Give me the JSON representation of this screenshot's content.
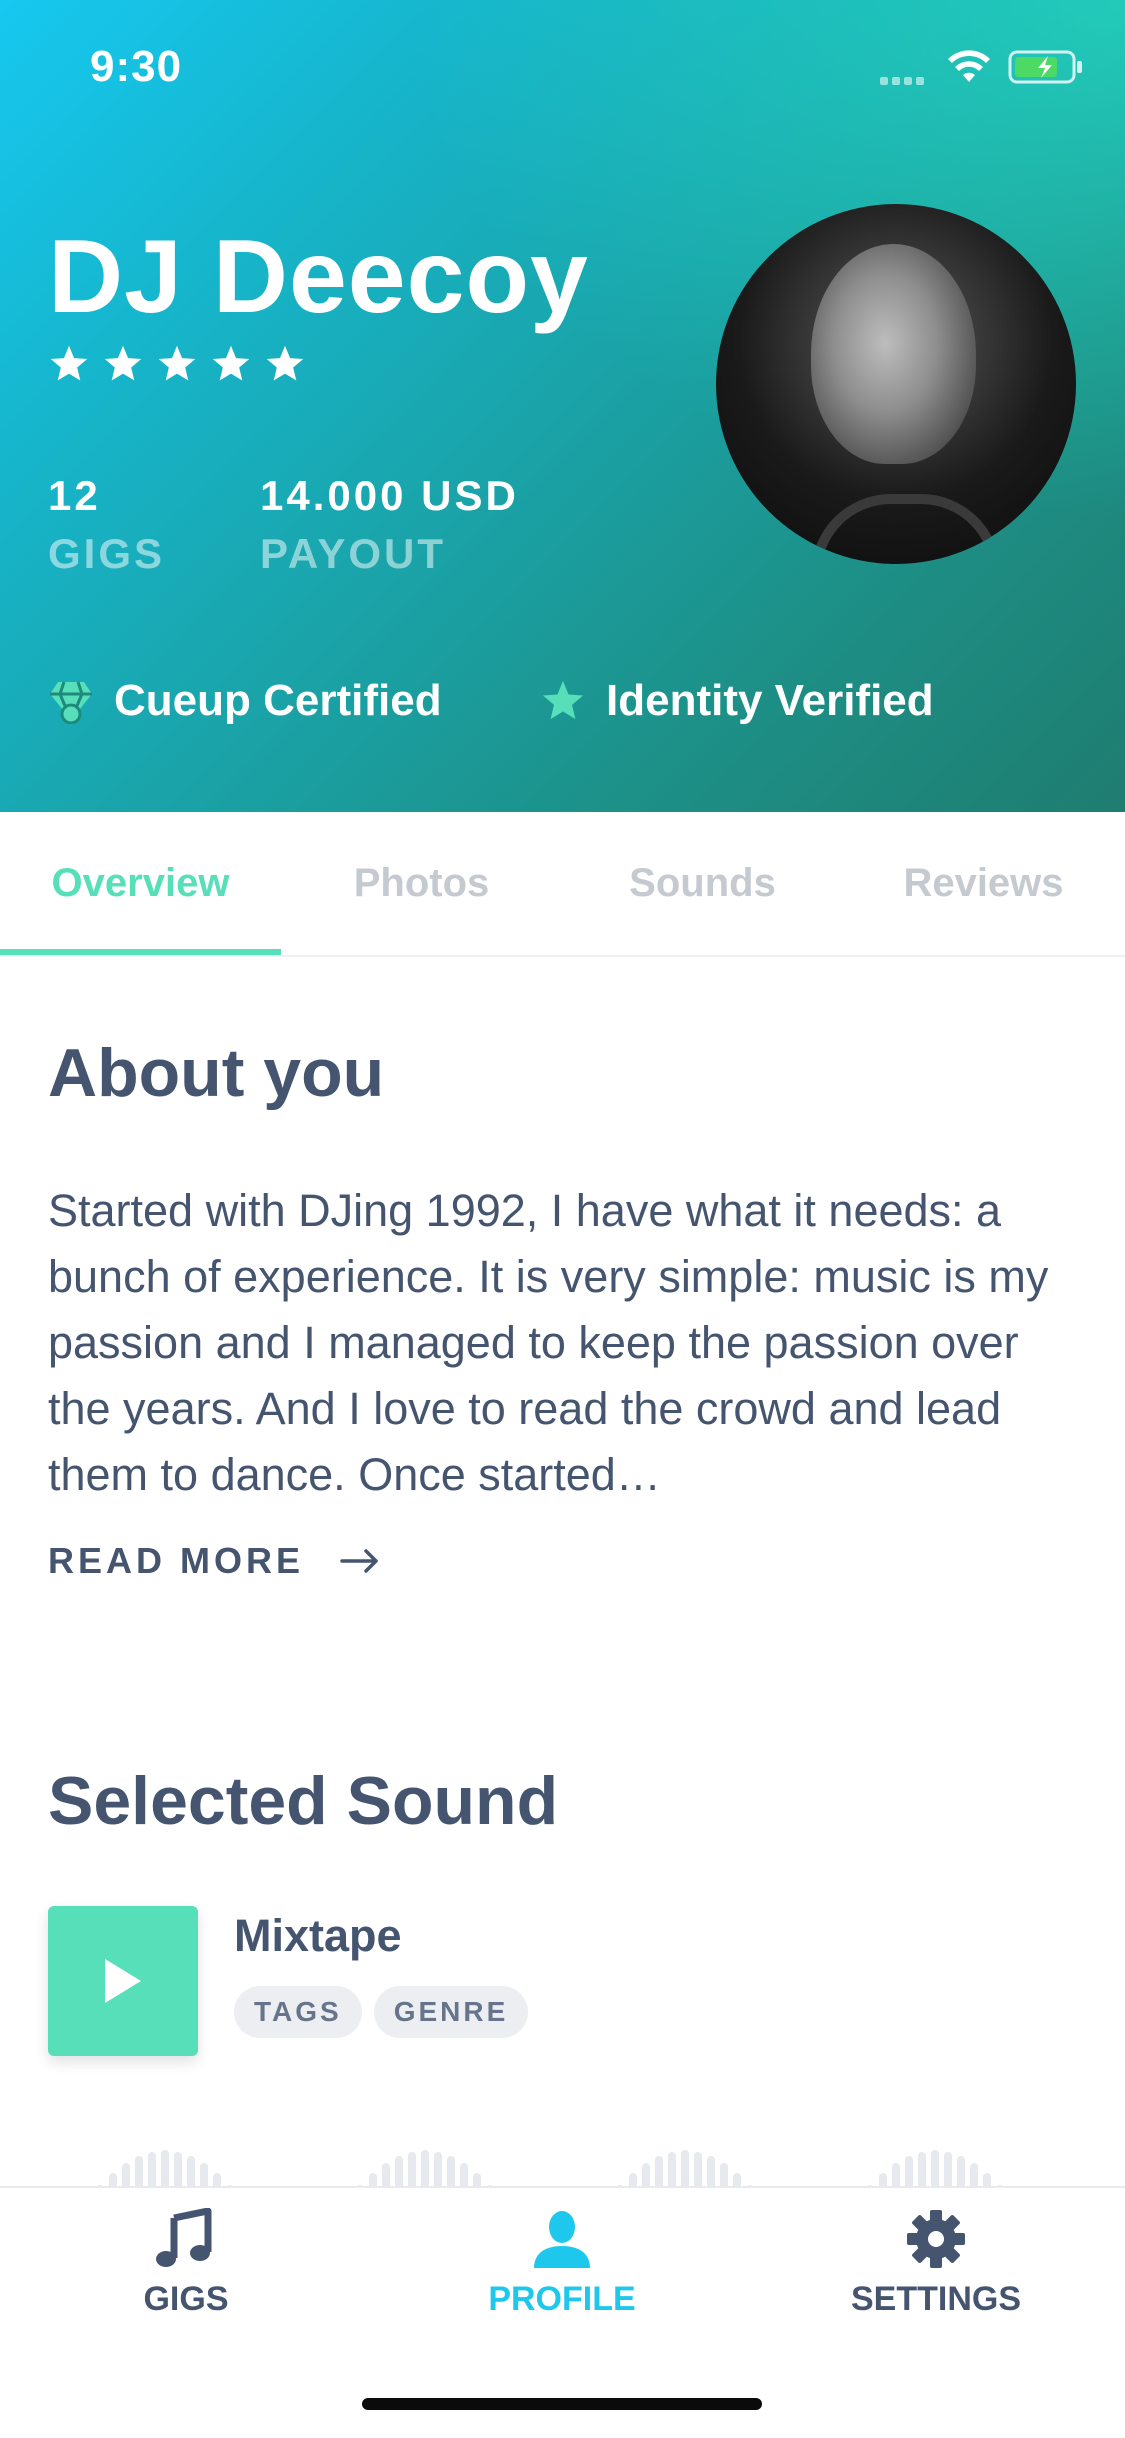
{
  "status_bar": {
    "time": "9:30"
  },
  "profile": {
    "name": "DJ Deecoy",
    "rating": 5,
    "stats": [
      {
        "value": "12",
        "label": "GIGS"
      },
      {
        "value": "14.000 USD",
        "label": "PAYOUT"
      }
    ],
    "badges": [
      {
        "label": "Cueup Certified",
        "icon": "diamond-icon"
      },
      {
        "label": "Identity Verified",
        "icon": "star-icon"
      }
    ]
  },
  "tabs": [
    {
      "label": "Overview",
      "active": true
    },
    {
      "label": "Photos",
      "active": false
    },
    {
      "label": "Sounds",
      "active": false
    },
    {
      "label": "Reviews",
      "active": false
    }
  ],
  "about": {
    "title": "About you",
    "text": "Started with DJing 1992, I have what it needs: a bunch of experience. It is very simple: music is my passion and I managed to keep the passion over the years. And I love to read the crowd and lead them to dance. Once started…",
    "read_more": "READ MORE"
  },
  "selected_sound": {
    "title": "Selected Sound",
    "track": "Mixtape",
    "tags": [
      "TAGS",
      "GENRE"
    ]
  },
  "bottom_nav": [
    {
      "label": "GIGS",
      "icon": "music-note-icon",
      "active": false
    },
    {
      "label": "PROFILE",
      "icon": "person-icon",
      "active": true
    },
    {
      "label": "SETTINGS",
      "icon": "gear-icon",
      "active": false
    }
  ],
  "colors": {
    "accent": "#56dfb9",
    "nav_active": "#1ec8ec",
    "text": "#45556f",
    "tab_inactive": "#c5cad1"
  }
}
